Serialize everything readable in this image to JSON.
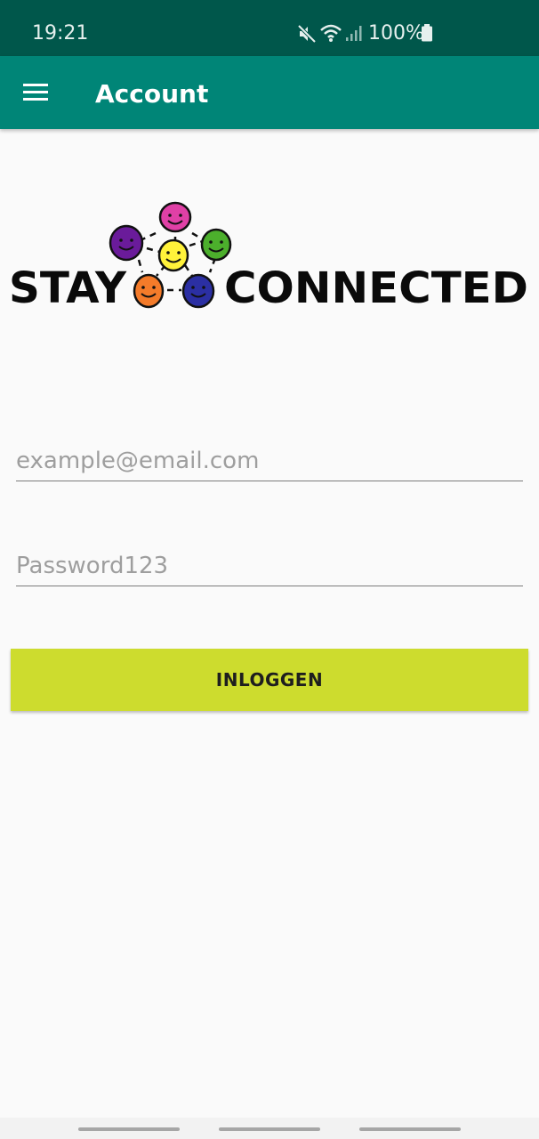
{
  "status_bar": {
    "time": "19:21",
    "battery": "100%",
    "icons": [
      "mute-icon",
      "wifi-icon",
      "signal-icon",
      "battery-icon"
    ]
  },
  "app_bar": {
    "title": "Account",
    "menu_icon": "hamburger-menu-icon",
    "color": "#008577"
  },
  "logo": {
    "word_left": "STAY",
    "word_right": "CONNECTED",
    "face_colors": [
      "#e040a6",
      "#6a1b9a",
      "#fff23a",
      "#4caf2c",
      "#f47b2a",
      "#2b2fa3"
    ]
  },
  "form": {
    "email_placeholder": "example@email.com",
    "password_placeholder": "Password123",
    "login_label": "INLOGGEN",
    "button_color": "#cddc2e"
  },
  "nav_bar": {
    "pills": 3
  }
}
